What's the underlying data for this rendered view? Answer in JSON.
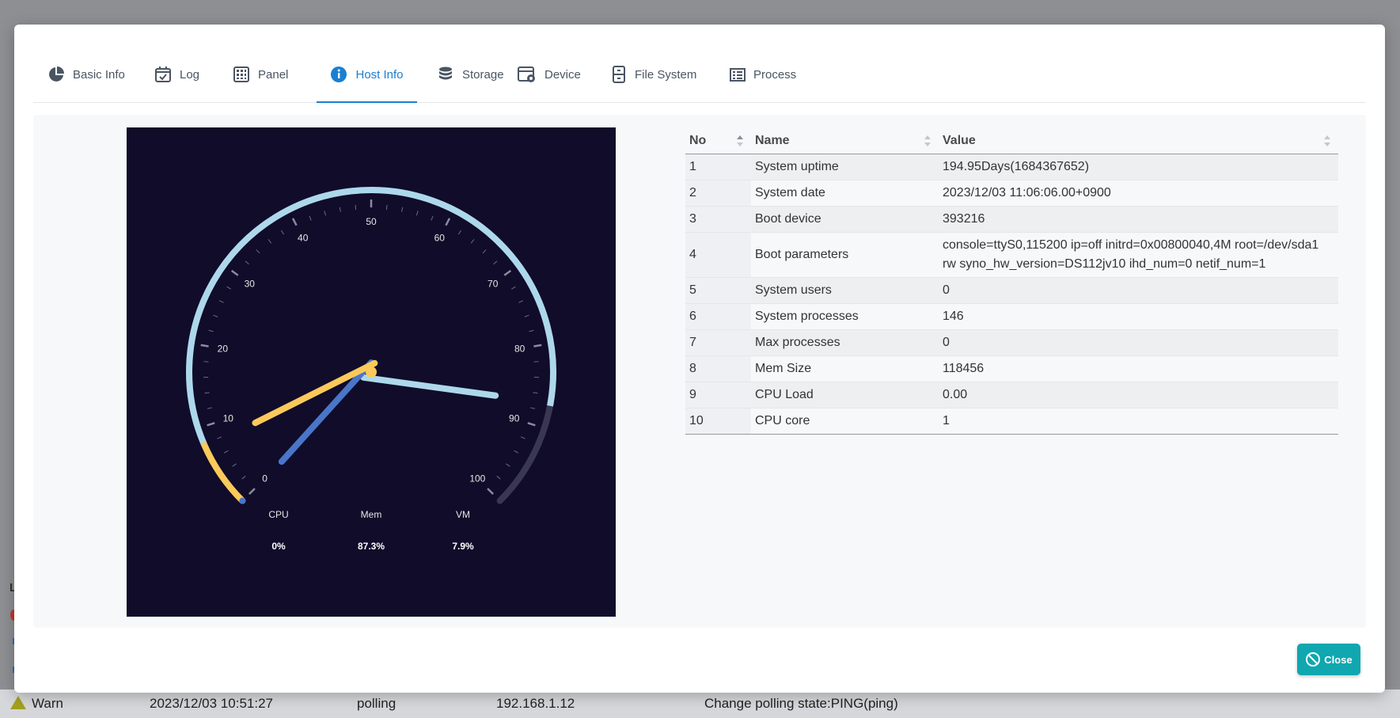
{
  "background": {
    "log_row": {
      "level": "Warn",
      "time": "2023/12/03 10:51:27",
      "type": "polling",
      "address": "192.168.1.12",
      "message": "Change polling state:PING(ping)"
    },
    "left_label": "L"
  },
  "tabs": [
    {
      "label": "Basic Info",
      "icon": "pie-chart-icon"
    },
    {
      "label": "Log",
      "icon": "calendar-check-icon"
    },
    {
      "label": "Panel",
      "icon": "grid-icon"
    },
    {
      "label": "Host Info",
      "icon": "info-icon",
      "active": true
    },
    {
      "label": "Storage",
      "icon": "database-icon"
    },
    {
      "label": "Device",
      "icon": "device-gear-icon"
    },
    {
      "label": "File System",
      "icon": "file-cabinet-icon"
    },
    {
      "label": "Process",
      "icon": "list-icon"
    }
  ],
  "gauge": {
    "min": 0,
    "max": 100,
    "tick_labels": [
      "0",
      "10",
      "20",
      "30",
      "40",
      "50",
      "60",
      "70",
      "80",
      "90",
      "100"
    ],
    "pointers": [
      {
        "name": "CPU",
        "value": 0,
        "display": "0%",
        "color": "#4a75c8"
      },
      {
        "name": "Mem",
        "value": 87.3,
        "display": "87.3%",
        "color": "#add8ec"
      },
      {
        "name": "VM",
        "value": 7.9,
        "display": "7.9%",
        "color": "#fbc95a"
      }
    ],
    "colors": {
      "background": "#100c2a",
      "track": "#3a3754"
    }
  },
  "table": {
    "headers": {
      "no": "No",
      "name": "Name",
      "value": "Value"
    },
    "rows": [
      {
        "no": "1",
        "name": "System uptime",
        "value": "194.95Days(1684367652)"
      },
      {
        "no": "2",
        "name": "System date",
        "value": "2023/12/03 11:06:06.00+0900"
      },
      {
        "no": "3",
        "name": "Boot device",
        "value": "393216"
      },
      {
        "no": "4",
        "name": "Boot parameters",
        "value": "console=ttyS0,115200 ip=off initrd=0x00800040,4M root=/dev/sda1 rw syno_hw_version=DS112jv10 ihd_num=0 netif_num=1"
      },
      {
        "no": "5",
        "name": "System users",
        "value": "0"
      },
      {
        "no": "6",
        "name": "System processes",
        "value": "146"
      },
      {
        "no": "7",
        "name": "Max processes",
        "value": "0"
      },
      {
        "no": "8",
        "name": "Mem Size",
        "value": "118456"
      },
      {
        "no": "9",
        "name": "CPU Load",
        "value": "0.00"
      },
      {
        "no": "10",
        "name": "CPU core",
        "value": "1"
      }
    ]
  },
  "close_button": {
    "label": "Close",
    "icon": "ban-icon"
  },
  "accent_color": "#1a7fd1",
  "close_color": "#10a7b0"
}
